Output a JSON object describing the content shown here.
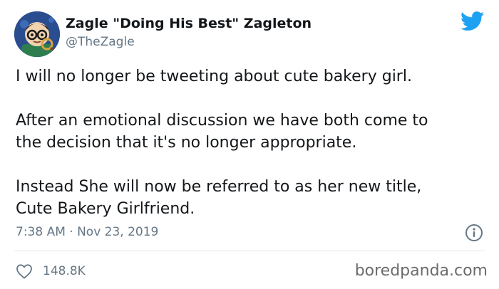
{
  "author": {
    "display_name": "Zagle \"Doing His Best\" Zagleton",
    "handle": "@TheZagle",
    "avatar_icon": "cartoon-character-avatar"
  },
  "platform_icon": "twitter-bird-icon",
  "tweet": {
    "paragraphs": [
      "I will no longer be tweeting about cute bakery girl.",
      "After an emotional discussion we have both come to",
      "the decision that it's no longer appropriate.",
      "Instead She will now be referred to as her new title,",
      "Cute Bakery Girlfriend."
    ],
    "timestamp": "7:38 AM · Nov 23, 2019"
  },
  "engagement": {
    "like_count": "148.8K"
  },
  "watermark": "boredpanda.com",
  "colors": {
    "twitter_blue": "#1da1f2",
    "secondary_text": "#657786",
    "divider": "#e1e8ed"
  }
}
